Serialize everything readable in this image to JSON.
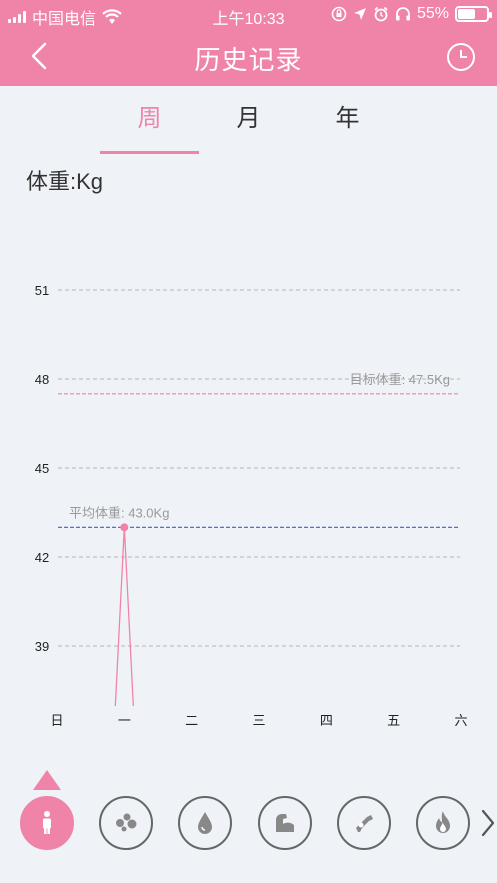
{
  "status": {
    "carrier": "中国电信",
    "time": "上午10:33",
    "battery": "55%",
    "battery_level": 0.55
  },
  "nav": {
    "title": "历史记录",
    "back_icon": "chevron-left-icon",
    "history_icon": "clock-icon"
  },
  "tabs": [
    {
      "label": "周",
      "active": true
    },
    {
      "label": "月",
      "active": false
    },
    {
      "label": "年",
      "active": false
    }
  ],
  "unit_label": "体重:Kg",
  "colors": {
    "accent": "#f083a8",
    "average_line": "#3b5fc4",
    "grid": "#b5b5b5"
  },
  "chart_data": {
    "type": "line",
    "categories": [
      "日",
      "一",
      "二",
      "三",
      "四",
      "五",
      "六"
    ],
    "values": [
      null,
      43.0,
      null,
      null,
      null,
      null,
      null
    ],
    "y_ticks": [
      51,
      48,
      45,
      42,
      39
    ],
    "ylim": [
      37,
      52
    ],
    "grid": true,
    "target": {
      "label": "目标体重: 47.5Kg",
      "value": 47.5
    },
    "average": {
      "label": "平均体重: 43.0Kg",
      "value": 43.0
    }
  },
  "metrics": [
    {
      "icon": "person-icon",
      "active": true
    },
    {
      "icon": "dots-icon",
      "active": false
    },
    {
      "icon": "water-drop-icon",
      "active": false
    },
    {
      "icon": "muscle-arm-icon",
      "active": false
    },
    {
      "icon": "bone-icon",
      "active": false
    },
    {
      "icon": "flame-icon",
      "active": false
    }
  ],
  "more_icon": "chevron-right-icon"
}
